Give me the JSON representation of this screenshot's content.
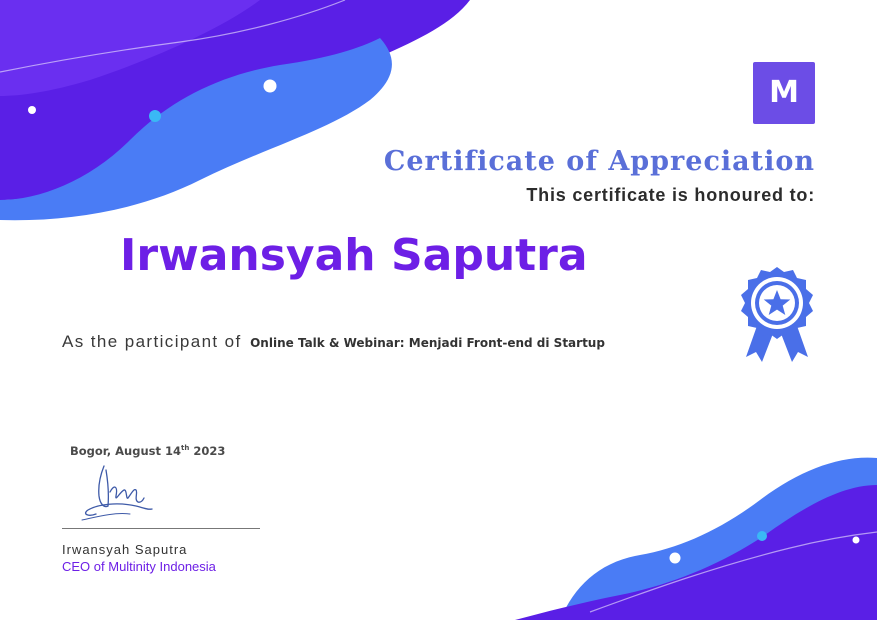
{
  "colors": {
    "primary_purple": "#5a1fe6",
    "wave_blue": "#4a7cf5",
    "title_blue": "#5a6fd8",
    "name_purple": "#6d1fe6"
  },
  "logo": {
    "letter": "M",
    "icon": "m-logo-icon"
  },
  "certificate": {
    "title": "Certificate of Appreciation",
    "subtitle": "This certificate is honoured to:",
    "recipient": "Irwansyah Saputra",
    "participant_prefix": "As the participant of",
    "event": "Online Talk & Webinar: Menjadi Front-end di Startup"
  },
  "badge": {
    "icon": "award-ribbon-star-icon"
  },
  "signature_block": {
    "place_date": "Bogor, August 14",
    "date_suffix": "th",
    "year": " 2023",
    "signer_name": "Irwansyah Saputra",
    "signer_role": "CEO of Multinity Indonesia"
  }
}
